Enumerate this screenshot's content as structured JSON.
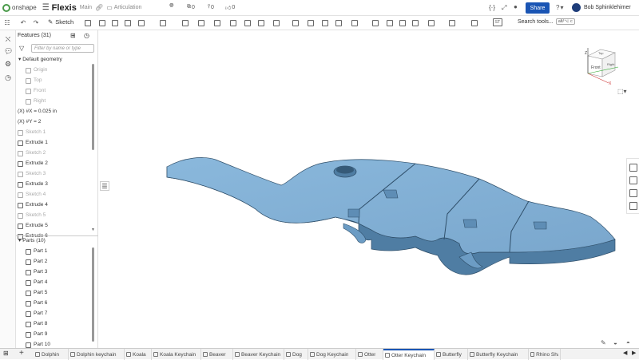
{
  "topbar": {
    "brand": "onshape",
    "doc_title": "Flexis",
    "branch": "Main",
    "folder": "Articulation",
    "counts": [
      "0",
      "0",
      "0"
    ],
    "share_label": "Share",
    "help": "?",
    "user": "Bob Sphinklehimer"
  },
  "toolbar": {
    "sketch_label": "Sketch",
    "search_label": "Search tools...",
    "shortcut": "alt/⌥ c",
    "st_label": "ST"
  },
  "panel": {
    "features_title": "Features (31)",
    "filter_placeholder": "Filter by name or type",
    "features": [
      {
        "label": "Default geometry",
        "kind": "group"
      },
      {
        "label": "Origin",
        "kind": "dim"
      },
      {
        "label": "Top",
        "kind": "plane"
      },
      {
        "label": "Front",
        "kind": "plane"
      },
      {
        "label": "Right",
        "kind": "plane"
      },
      {
        "label": "(X) #X = 0.025 in",
        "kind": "var"
      },
      {
        "label": "(X) #Y = 2",
        "kind": "var"
      },
      {
        "label": "Sketch 1",
        "kind": "sketch"
      },
      {
        "label": "Extrude 1",
        "kind": "extrude"
      },
      {
        "label": "Sketch 2",
        "kind": "sketch"
      },
      {
        "label": "Extrude 2",
        "kind": "extrude"
      },
      {
        "label": "Sketch 3",
        "kind": "sketch"
      },
      {
        "label": "Extrude 3",
        "kind": "extrude"
      },
      {
        "label": "Sketch 4",
        "kind": "sketch"
      },
      {
        "label": "Extrude 4",
        "kind": "extrude"
      },
      {
        "label": "Sketch 5",
        "kind": "sketch"
      },
      {
        "label": "Extrude 5",
        "kind": "extrude"
      },
      {
        "label": "Extrude 6",
        "kind": "extrude"
      }
    ],
    "parts_title": "Parts (10)",
    "parts": [
      "Part 1",
      "Part 2",
      "Part 3",
      "Part 4",
      "Part 5",
      "Part 6",
      "Part 7",
      "Part 8",
      "Part 9",
      "Part 10"
    ]
  },
  "viewcube": {
    "top": "Top",
    "front": "Front",
    "right": "Right",
    "x": "X",
    "z": "Z"
  },
  "tabs": [
    "Dolphin",
    "Dolphin keychain",
    "Koala",
    "Koala Keychain",
    "Beaver",
    "Beaver Keychain",
    "Dog",
    "Dog Keychain",
    "Otter",
    "Otter Keychain",
    "Butterfly",
    "Butterfly Keychain",
    "Rhino Shark"
  ],
  "active_tab": "Otter Keychain",
  "colors": {
    "accent": "#1a55b4",
    "model": "#7faed3",
    "model_side": "#4f7da3"
  }
}
